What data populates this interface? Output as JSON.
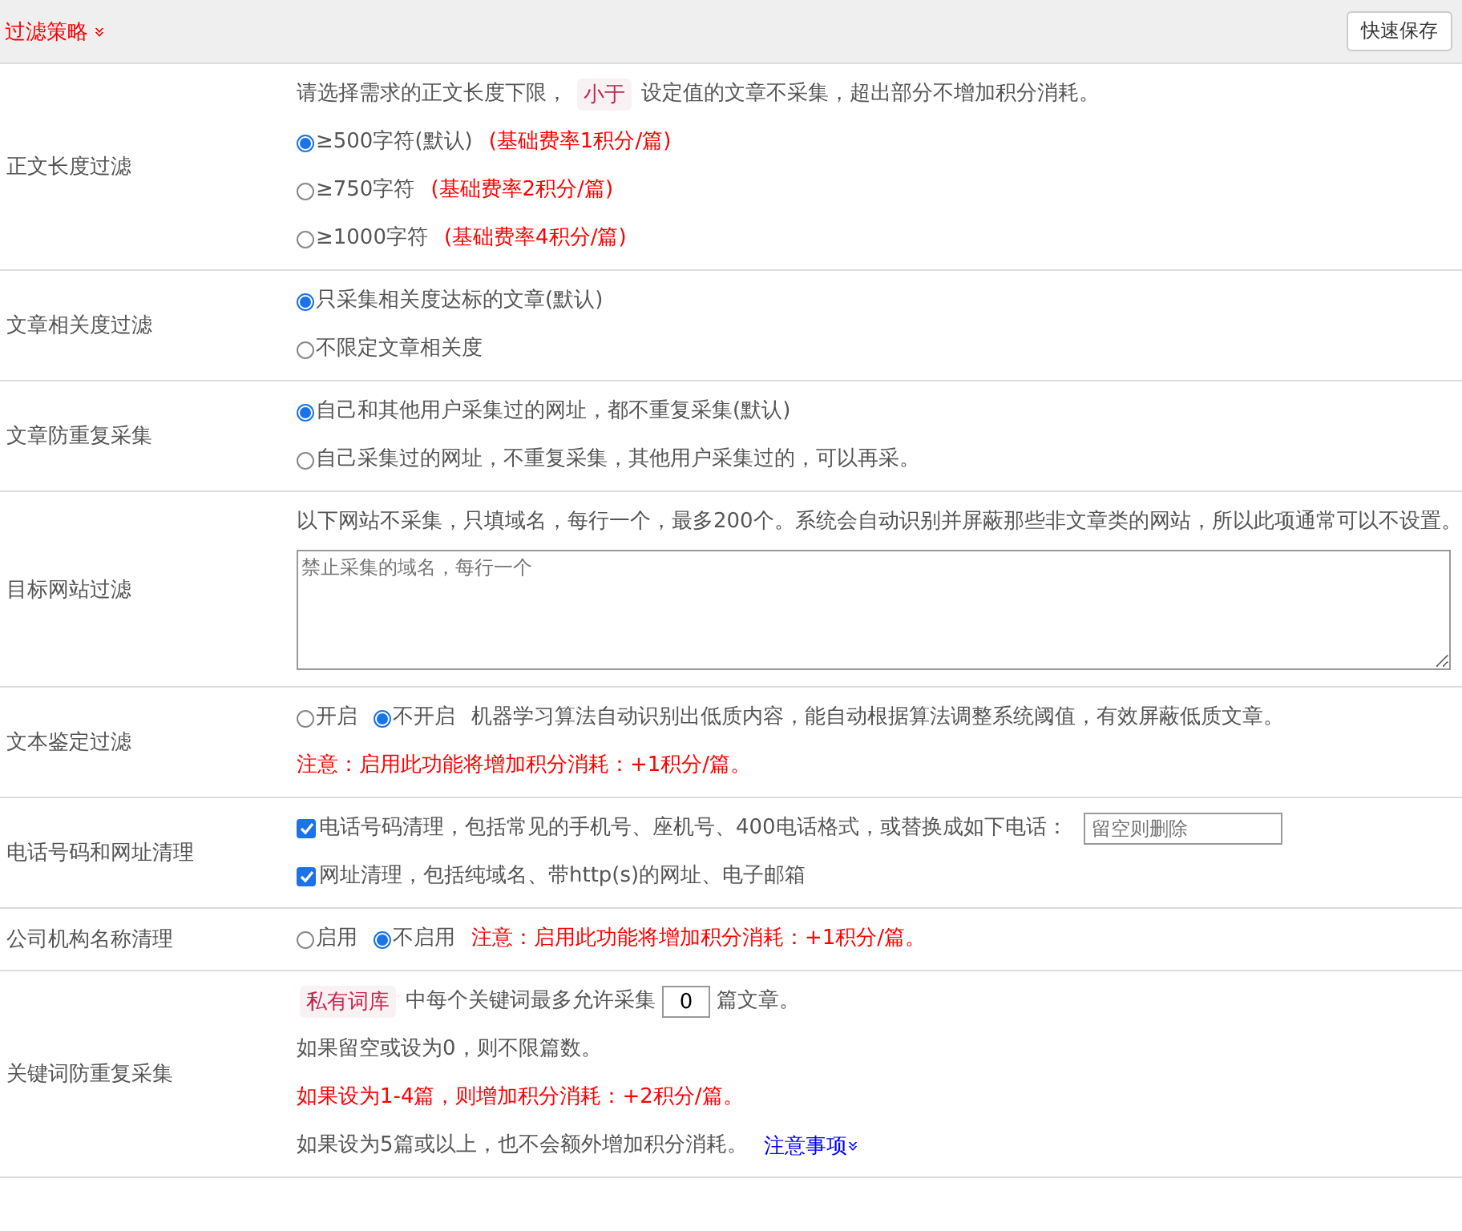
{
  "header": {
    "title": "过滤策略",
    "expand_icon": "»",
    "save_button": "快速保存"
  },
  "sections": [
    {
      "label": "正文长度过滤",
      "lines": [
        [
          {
            "kind": "text",
            "text": "请选择需求的正文长度下限，"
          },
          {
            "kind": "tag",
            "text": "小于"
          },
          {
            "kind": "text",
            "text": "设定值的文章不采集，超出部分不增加积分消耗。"
          }
        ],
        [
          {
            "kind": "radio",
            "text": "≥500字符(默认)",
            "selected": true
          },
          {
            "kind": "warn",
            "text": "(基础费率1积分/篇)"
          }
        ],
        [
          {
            "kind": "radio",
            "text": "≥750字符",
            "selected": false
          },
          {
            "kind": "warn",
            "text": "(基础费率2积分/篇)"
          }
        ],
        [
          {
            "kind": "radio",
            "text": "≥1000字符",
            "selected": false
          },
          {
            "kind": "warn",
            "text": "(基础费率4积分/篇)"
          }
        ]
      ]
    },
    {
      "label": "文章相关度过滤",
      "lines": [
        [
          {
            "kind": "radio",
            "text": "只采集相关度达标的文章(默认)",
            "selected": true
          }
        ],
        [
          {
            "kind": "radio",
            "text": "不限定文章相关度",
            "selected": false
          }
        ]
      ]
    },
    {
      "label": "文章防重复采集",
      "lines": [
        [
          {
            "kind": "radio",
            "text": "自己和其他用户采集过的网址，都不重复采集(默认)",
            "selected": true
          }
        ],
        [
          {
            "kind": "radio",
            "text": "自己采集过的网址，不重复采集，其他用户采集过的，可以再采。",
            "selected": false
          }
        ]
      ]
    },
    {
      "label": "目标网站过滤",
      "lines": [
        [
          {
            "kind": "text",
            "text": "以下网站不采集，只填域名，每行一个，最多200个。系统会自动识别并屏蔽那些非文章类的网站，所以此项通常可以不设置。"
          }
        ],
        [
          {
            "kind": "textarea",
            "placeholder": "禁止采集的域名，每行一个"
          }
        ]
      ]
    },
    {
      "label": "文本鉴定过滤",
      "lines": [
        [
          {
            "kind": "radio",
            "text": "开启",
            "selected": false
          },
          {
            "kind": "radio",
            "text": "不开启",
            "selected": true
          },
          {
            "kind": "text",
            "text": "机器学习算法自动识别出低质内容，能自动根据算法调整系统阈值，有效屏蔽低质文章。"
          }
        ],
        [
          {
            "kind": "warn",
            "text": "注意：启用此功能将增加积分消耗：+1积分/篇。"
          }
        ]
      ]
    },
    {
      "label": "电话号码和网址清理",
      "lines": [
        [
          {
            "kind": "checkbox",
            "text": "电话号码清理，包括常见的手机号、座机号、400电话格式，或替换成如下电话：",
            "checked": true
          },
          {
            "kind": "input",
            "placeholder": "留空则删除"
          }
        ],
        [
          {
            "kind": "checkbox",
            "text": "网址清理，包括纯域名、带http(s)的网址、电子邮箱",
            "checked": true
          }
        ]
      ]
    },
    {
      "label": "公司机构名称清理",
      "lines": [
        [
          {
            "kind": "radio",
            "text": "启用",
            "selected": false
          },
          {
            "kind": "radio",
            "text": "不启用",
            "selected": true
          },
          {
            "kind": "warn",
            "text": "注意：启用此功能将增加积分消耗：+1积分/篇。"
          }
        ]
      ]
    },
    {
      "label": "关键词防重复采集",
      "lines": [
        [
          {
            "kind": "tag",
            "text": "私有词库"
          },
          {
            "kind": "text",
            "text": "中每个关键词最多允许采集"
          },
          {
            "kind": "number",
            "value": "0"
          },
          {
            "kind": "text",
            "text": "篇文章。"
          }
        ],
        [
          {
            "kind": "text",
            "text": "如果留空或设为0，则不限篇数。"
          }
        ],
        [
          {
            "kind": "warn",
            "text": "如果设为1-4篇，则增加积分消耗：+2积分/篇。"
          }
        ],
        [
          {
            "kind": "text",
            "text": "如果设为5篇或以上，也不会额外增加积分消耗。"
          },
          {
            "kind": "link",
            "text": "注意事项",
            "icon": "»"
          }
        ]
      ]
    }
  ]
}
